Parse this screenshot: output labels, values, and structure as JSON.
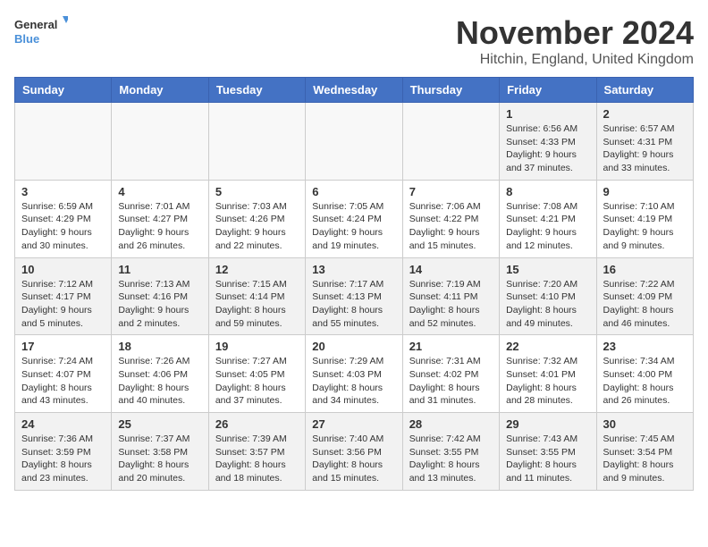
{
  "logo": {
    "text_general": "General",
    "text_blue": "Blue"
  },
  "title": "November 2024",
  "location": "Hitchin, England, United Kingdom",
  "days_of_week": [
    "Sunday",
    "Monday",
    "Tuesday",
    "Wednesday",
    "Thursday",
    "Friday",
    "Saturday"
  ],
  "weeks": [
    [
      {
        "day": "",
        "info": ""
      },
      {
        "day": "",
        "info": ""
      },
      {
        "day": "",
        "info": ""
      },
      {
        "day": "",
        "info": ""
      },
      {
        "day": "",
        "info": ""
      },
      {
        "day": "1",
        "info": "Sunrise: 6:56 AM\nSunset: 4:33 PM\nDaylight: 9 hours\nand 37 minutes."
      },
      {
        "day": "2",
        "info": "Sunrise: 6:57 AM\nSunset: 4:31 PM\nDaylight: 9 hours\nand 33 minutes."
      }
    ],
    [
      {
        "day": "3",
        "info": "Sunrise: 6:59 AM\nSunset: 4:29 PM\nDaylight: 9 hours\nand 30 minutes."
      },
      {
        "day": "4",
        "info": "Sunrise: 7:01 AM\nSunset: 4:27 PM\nDaylight: 9 hours\nand 26 minutes."
      },
      {
        "day": "5",
        "info": "Sunrise: 7:03 AM\nSunset: 4:26 PM\nDaylight: 9 hours\nand 22 minutes."
      },
      {
        "day": "6",
        "info": "Sunrise: 7:05 AM\nSunset: 4:24 PM\nDaylight: 9 hours\nand 19 minutes."
      },
      {
        "day": "7",
        "info": "Sunrise: 7:06 AM\nSunset: 4:22 PM\nDaylight: 9 hours\nand 15 minutes."
      },
      {
        "day": "8",
        "info": "Sunrise: 7:08 AM\nSunset: 4:21 PM\nDaylight: 9 hours\nand 12 minutes."
      },
      {
        "day": "9",
        "info": "Sunrise: 7:10 AM\nSunset: 4:19 PM\nDaylight: 9 hours\nand 9 minutes."
      }
    ],
    [
      {
        "day": "10",
        "info": "Sunrise: 7:12 AM\nSunset: 4:17 PM\nDaylight: 9 hours\nand 5 minutes."
      },
      {
        "day": "11",
        "info": "Sunrise: 7:13 AM\nSunset: 4:16 PM\nDaylight: 9 hours\nand 2 minutes."
      },
      {
        "day": "12",
        "info": "Sunrise: 7:15 AM\nSunset: 4:14 PM\nDaylight: 8 hours\nand 59 minutes."
      },
      {
        "day": "13",
        "info": "Sunrise: 7:17 AM\nSunset: 4:13 PM\nDaylight: 8 hours\nand 55 minutes."
      },
      {
        "day": "14",
        "info": "Sunrise: 7:19 AM\nSunset: 4:11 PM\nDaylight: 8 hours\nand 52 minutes."
      },
      {
        "day": "15",
        "info": "Sunrise: 7:20 AM\nSunset: 4:10 PM\nDaylight: 8 hours\nand 49 minutes."
      },
      {
        "day": "16",
        "info": "Sunrise: 7:22 AM\nSunset: 4:09 PM\nDaylight: 8 hours\nand 46 minutes."
      }
    ],
    [
      {
        "day": "17",
        "info": "Sunrise: 7:24 AM\nSunset: 4:07 PM\nDaylight: 8 hours\nand 43 minutes."
      },
      {
        "day": "18",
        "info": "Sunrise: 7:26 AM\nSunset: 4:06 PM\nDaylight: 8 hours\nand 40 minutes."
      },
      {
        "day": "19",
        "info": "Sunrise: 7:27 AM\nSunset: 4:05 PM\nDaylight: 8 hours\nand 37 minutes."
      },
      {
        "day": "20",
        "info": "Sunrise: 7:29 AM\nSunset: 4:03 PM\nDaylight: 8 hours\nand 34 minutes."
      },
      {
        "day": "21",
        "info": "Sunrise: 7:31 AM\nSunset: 4:02 PM\nDaylight: 8 hours\nand 31 minutes."
      },
      {
        "day": "22",
        "info": "Sunrise: 7:32 AM\nSunset: 4:01 PM\nDaylight: 8 hours\nand 28 minutes."
      },
      {
        "day": "23",
        "info": "Sunrise: 7:34 AM\nSunset: 4:00 PM\nDaylight: 8 hours\nand 26 minutes."
      }
    ],
    [
      {
        "day": "24",
        "info": "Sunrise: 7:36 AM\nSunset: 3:59 PM\nDaylight: 8 hours\nand 23 minutes."
      },
      {
        "day": "25",
        "info": "Sunrise: 7:37 AM\nSunset: 3:58 PM\nDaylight: 8 hours\nand 20 minutes."
      },
      {
        "day": "26",
        "info": "Sunrise: 7:39 AM\nSunset: 3:57 PM\nDaylight: 8 hours\nand 18 minutes."
      },
      {
        "day": "27",
        "info": "Sunrise: 7:40 AM\nSunset: 3:56 PM\nDaylight: 8 hours\nand 15 minutes."
      },
      {
        "day": "28",
        "info": "Sunrise: 7:42 AM\nSunset: 3:55 PM\nDaylight: 8 hours\nand 13 minutes."
      },
      {
        "day": "29",
        "info": "Sunrise: 7:43 AM\nSunset: 3:55 PM\nDaylight: 8 hours\nand 11 minutes."
      },
      {
        "day": "30",
        "info": "Sunrise: 7:45 AM\nSunset: 3:54 PM\nDaylight: 8 hours\nand 9 minutes."
      }
    ]
  ]
}
